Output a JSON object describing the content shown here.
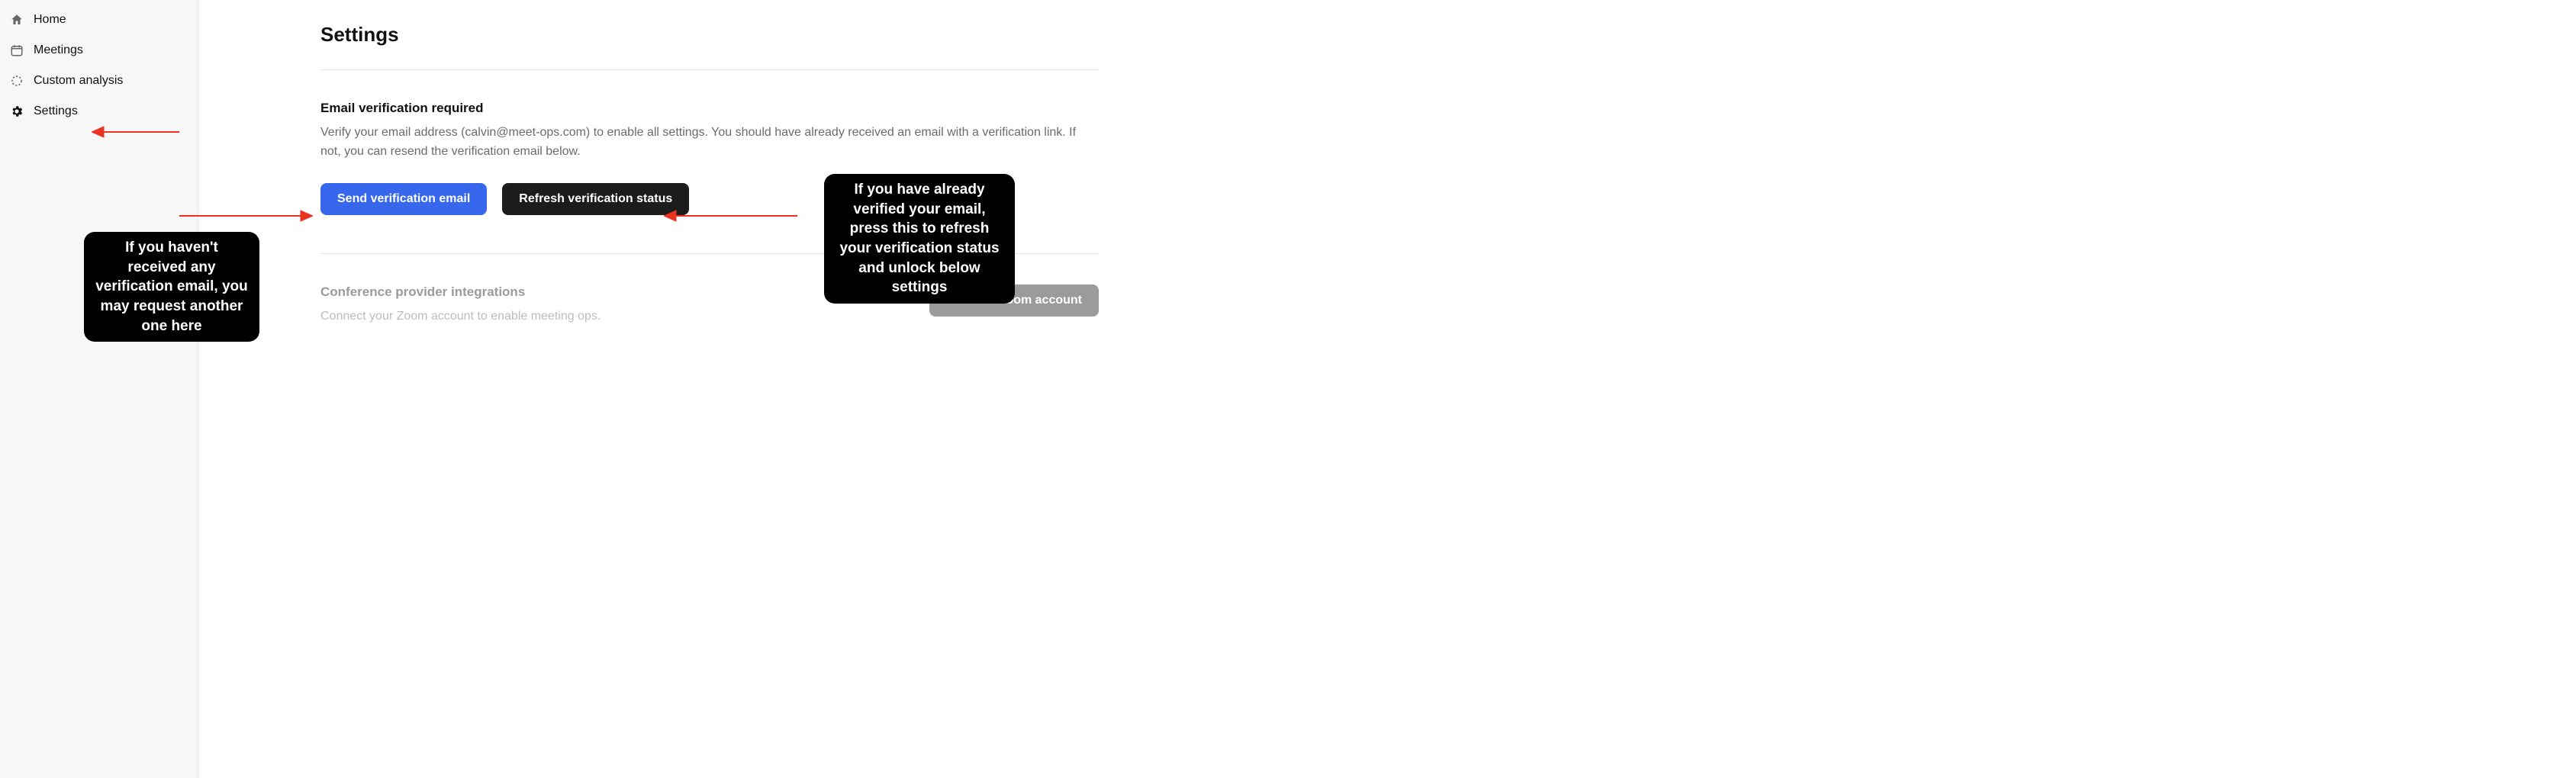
{
  "sidebar": {
    "items": [
      {
        "label": "Home"
      },
      {
        "label": "Meetings"
      },
      {
        "label": "Custom analysis"
      },
      {
        "label": "Settings"
      }
    ]
  },
  "page": {
    "title": "Settings"
  },
  "verification": {
    "heading": "Email verification required",
    "body": "Verify your email address (calvin@meet-ops.com) to enable all settings. You should have already received an email with a verification link. If not, you can resend the verification email below.",
    "send_button": "Send verification email",
    "refresh_button": "Refresh verification status"
  },
  "integration": {
    "heading": "Conference provider integrations",
    "body": "Connect your Zoom account to enable meeting ops.",
    "connect_button": "Connect Zoom account"
  },
  "annotations": {
    "settings_arrow": "",
    "send_callout": "If you haven't received any verification email, you may request another one here",
    "refresh_callout": "If you have already verified your email, press this to refresh your verification status and unlock below settings"
  }
}
